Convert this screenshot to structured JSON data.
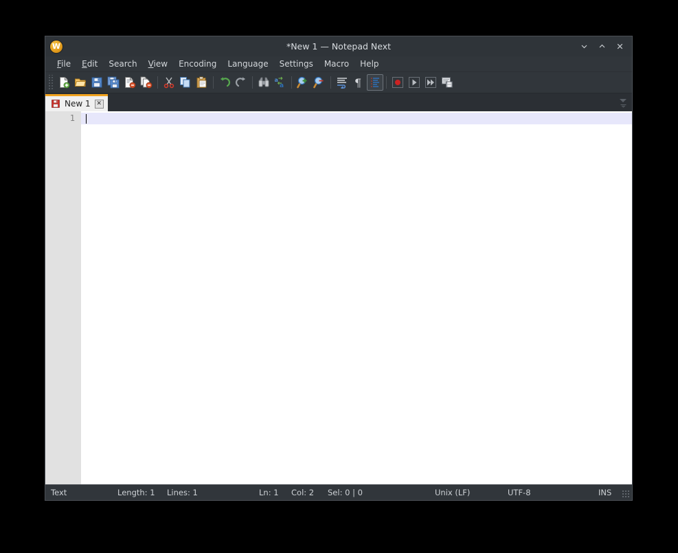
{
  "window": {
    "title": "*New 1 — Notepad Next",
    "app_icon": "notepad-next-logo-icon",
    "controls": [
      {
        "name": "minimize-button",
        "icon": "chevron-down-icon",
        "label": "Minimize"
      },
      {
        "name": "maximize-button",
        "icon": "chevron-up-icon",
        "label": "Maximize"
      },
      {
        "name": "close-button",
        "icon": "close-x-icon",
        "label": "Close"
      }
    ]
  },
  "menubar": {
    "items": [
      {
        "label": "File",
        "mnemonic": "F"
      },
      {
        "label": "Edit",
        "mnemonic": "E"
      },
      {
        "label": "Search",
        "mnemonic": ""
      },
      {
        "label": "View",
        "mnemonic": "V"
      },
      {
        "label": "Encoding",
        "mnemonic": ""
      },
      {
        "label": "Language",
        "mnemonic": ""
      },
      {
        "label": "Settings",
        "mnemonic": ""
      },
      {
        "label": "Macro",
        "mnemonic": ""
      },
      {
        "label": "Help",
        "mnemonic": ""
      }
    ]
  },
  "toolbar": {
    "buttons": [
      {
        "name": "new-file-button",
        "icon": "new-document-icon",
        "label": "New"
      },
      {
        "name": "open-file-button",
        "icon": "open-folder-icon",
        "label": "Open"
      },
      {
        "name": "save-file-button",
        "icon": "floppy-disk-icon",
        "label": "Save"
      },
      {
        "name": "save-all-button",
        "icon": "save-all-icon",
        "label": "Save All"
      },
      {
        "name": "close-file-button",
        "icon": "close-document-icon",
        "label": "Close"
      },
      {
        "name": "close-all-button",
        "icon": "close-all-documents-icon",
        "label": "Close All"
      },
      {
        "name": "cut-button",
        "icon": "scissors-icon",
        "label": "Cut"
      },
      {
        "name": "copy-button",
        "icon": "copy-pages-icon",
        "label": "Copy"
      },
      {
        "name": "paste-button",
        "icon": "clipboard-paste-icon",
        "label": "Paste"
      },
      {
        "name": "undo-button",
        "icon": "undo-arrow-icon",
        "label": "Undo"
      },
      {
        "name": "redo-button",
        "icon": "redo-arrow-icon",
        "label": "Redo"
      },
      {
        "name": "find-button",
        "icon": "binoculars-find-icon",
        "label": "Find"
      },
      {
        "name": "replace-button",
        "icon": "find-replace-icon",
        "label": "Replace"
      },
      {
        "name": "zoom-in-button",
        "icon": "magnifier-plus-icon",
        "label": "Zoom In"
      },
      {
        "name": "zoom-out-button",
        "icon": "magnifier-minus-icon",
        "label": "Zoom Out"
      },
      {
        "name": "word-wrap-button",
        "icon": "word-wrap-icon",
        "label": "Word Wrap"
      },
      {
        "name": "show-all-characters-button",
        "icon": "pilcrow-icon",
        "label": "Show All Characters"
      },
      {
        "name": "indent-guide-button",
        "icon": "indent-guide-icon",
        "label": "Show Indent Guide"
      },
      {
        "name": "record-macro-button",
        "icon": "record-circle-icon",
        "label": "Start Recording"
      },
      {
        "name": "play-macro-button",
        "icon": "play-triangle-icon",
        "label": "Playback"
      },
      {
        "name": "run-macro-multiple-button",
        "icon": "fast-forward-icon",
        "label": "Run a Macro Multiple Times"
      },
      {
        "name": "save-macro-button",
        "icon": "save-macro-icon",
        "label": "Save Current Recorded Macro"
      }
    ],
    "active_button": "indent-guide-button"
  },
  "tabbar": {
    "tabs": [
      {
        "label": "New 1",
        "icon": "unsaved-floppy-icon",
        "close_glyph": "✕",
        "active": true
      }
    ],
    "tab_list_button": "chevron-down-icon"
  },
  "editor": {
    "line_numbers": [
      "1"
    ],
    "content": ""
  },
  "statusbar": {
    "language": "Text",
    "length": "Length: 1",
    "lines": "Lines: 1",
    "ln": "Ln: 1",
    "col": "Col: 2",
    "sel": "Sel: 0 | 0",
    "eol": "Unix (LF)",
    "encoding": "UTF-8",
    "overtype": "INS"
  },
  "colors": {
    "window_chrome": "#31363b",
    "titlebar": "#2f3439",
    "accent_tab": "#f0a21e",
    "editor_bg": "#ffffff",
    "gutter_bg": "#e1e1e1",
    "caret_line": "#e7e7fb",
    "text_light": "#d2d6da"
  }
}
